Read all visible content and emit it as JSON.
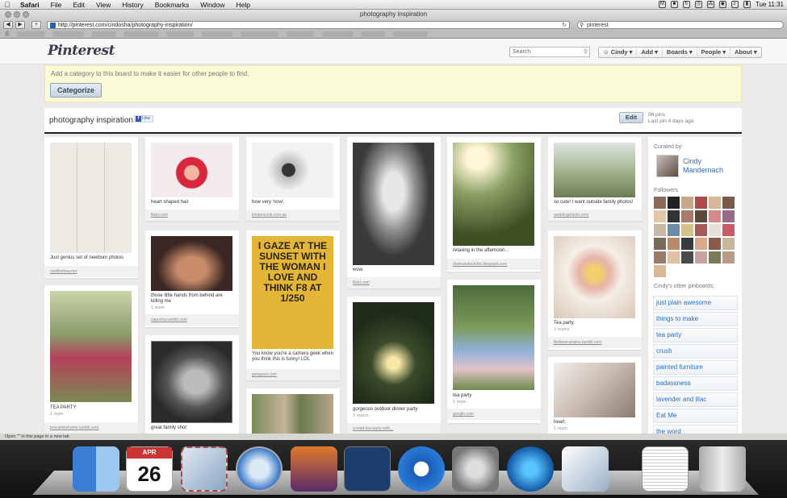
{
  "menubar": {
    "items": [
      "Safari",
      "File",
      "Edit",
      "View",
      "History",
      "Bookmarks",
      "Window",
      "Help"
    ],
    "clock": "Tue 11:31"
  },
  "window": {
    "title": "photography inspiration"
  },
  "toolbar": {
    "url": "http://pinterest.com/cindosha/photography-inspiration/",
    "search_value": "pinterest"
  },
  "header": {
    "logo": "Pinterest",
    "search_placeholder": "Search",
    "nav": [
      "Cindy",
      "Add",
      "Boards",
      "People",
      "About"
    ]
  },
  "category": {
    "message": "Add a category to this board to make it easier for other people to find.",
    "button": "Categorize"
  },
  "board": {
    "title": "photography inspiration",
    "like": "Like",
    "edit": "Edit",
    "pins": "96 pins",
    "last_pin": "Last pin 4 days ago"
  },
  "pins": [
    {
      "desc": "Just genius set of newborn photos",
      "repins": "",
      "source": "ownlinetrav.net"
    },
    {
      "desc": "TEA PARTY",
      "repins": "1 repin",
      "source": "brocanteshome.tumblr.com"
    },
    {
      "desc": "heart shaped hair",
      "repins": "",
      "source": "flickr.com"
    },
    {
      "desc": "those little hands from behind are killing me",
      "repins": "1 repin",
      "source": "capucha.tumblr.com"
    },
    {
      "desc": "great family shot",
      "repins": "",
      "source": ""
    },
    {
      "desc": "how very 'now'.",
      "repins": "",
      "source": "kristencook.com.au"
    },
    {
      "desc": "You know you're a camera geek when you think this is funny! LOL",
      "repins": "",
      "source": "petapixel.com"
    },
    {
      "desc": "wow.",
      "repins": "",
      "source": "flickr.com"
    },
    {
      "desc": "gorgeous outdoor dinner party",
      "repins": "2 repins",
      "source": "a-mad-tea-party-with..."
    },
    {
      "desc": "relaxing in the afternoon...",
      "repins": "",
      "source": "downandoutchic.blogspot.com"
    },
    {
      "desc": "tea party",
      "repins": "1 repin",
      "source": "google.com"
    },
    {
      "desc": "so cute! I want outside family photos!",
      "repins": "",
      "source": "weddingchicks.com"
    },
    {
      "desc": "Tea party.",
      "repins": "2 repins",
      "source": "thelacecurtains.tumblr.com"
    },
    {
      "desc": "heart.",
      "repins": "1 repin",
      "source": ""
    }
  ],
  "poster_text": "I GAZE AT THE SUNSET WITH THE WOMAN I LOVE AND THINK F8 AT 1/250",
  "sidebar": {
    "curated_by": "Curated by:",
    "curator": "Cindy Mandernach",
    "followers": "Followers",
    "other_boards_label": "Cindy's other pinboards:",
    "boards": [
      "just plain awesome",
      "things to make",
      "tea party",
      "crush",
      "painted furniture",
      "badassness",
      "lavender and lilac",
      "Eat Me",
      "the word"
    ]
  },
  "statusbar": "Open \"\" in this page in a new tab",
  "dock": {
    "calendar_month": "APR",
    "calendar_day": "26"
  },
  "colors": {
    "link": "#2a70c2",
    "category_bg": "#fbfad7",
    "pinterest_logo": "#3b3b4d"
  }
}
